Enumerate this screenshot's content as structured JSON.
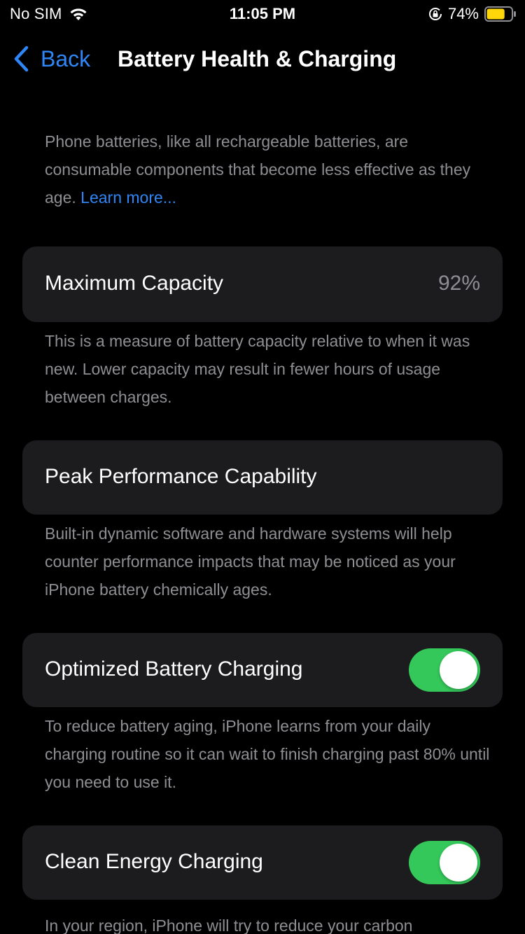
{
  "status_bar": {
    "carrier": "No SIM",
    "time": "11:05 PM",
    "battery_percent": "74%",
    "battery_level": 0.74,
    "battery_color": "#ffd60a",
    "icons": [
      "wifi-icon",
      "orientation-lock-icon",
      "battery-icon"
    ]
  },
  "nav": {
    "back_label": "Back",
    "title": "Battery Health & Charging"
  },
  "intro": {
    "text": "Phone batteries, like all rechargeable batteries, are consumable components that become less effective as they age.",
    "link": "Learn more..."
  },
  "max_capacity": {
    "label": "Maximum Capacity",
    "value": "92%",
    "footnote": "This is a measure of battery capacity relative to when it was new. Lower capacity may result in fewer hours of usage between charges."
  },
  "peak_performance": {
    "label": "Peak Performance Capability",
    "footnote": "Built-in dynamic software and hardware systems will help counter performance impacts that may be noticed as your iPhone battery chemically ages."
  },
  "optimized_charging": {
    "label": "Optimized Battery Charging",
    "enabled": true,
    "footnote": "To reduce battery aging, iPhone learns from your daily charging routine so it can wait to finish charging past 80% until you need to use it."
  },
  "clean_energy": {
    "label": "Clean Energy Charging",
    "enabled": true,
    "footnote": "In your region, iPhone will try to reduce your carbon"
  },
  "colors": {
    "accent": "#2f86f6",
    "toggle_on": "#34c759",
    "card_bg": "#1c1c1e",
    "secondary_text": "#8e8e93"
  }
}
